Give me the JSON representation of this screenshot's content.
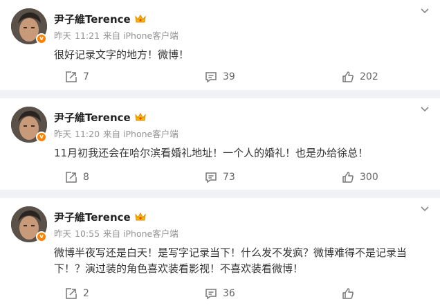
{
  "posts": [
    {
      "user": "尹子維Terence",
      "date": "昨天",
      "time": "11:21",
      "source": "来自 iPhone客户端",
      "text": "很好记录文字的地方！微博！",
      "reposts": "7",
      "comments": "39",
      "likes": "202"
    },
    {
      "user": "尹子維Terence",
      "date": "昨天",
      "time": "11:20",
      "source": "来自 iPhone客户端",
      "text": "11月初我还会在哈尔滨看婚礼地址！一个人的婚礼！也是办给徐总！",
      "reposts": "8",
      "comments": "73",
      "likes": "300"
    },
    {
      "user": "尹子維Terence",
      "date": "昨天",
      "time": "10:55",
      "source": "来自 iPhone客户端",
      "text": "微博半夜写还是白天！是写字记录当下！什么发不发疯？微博难得不是记录当下！？演过装的角色喜欢装看影视！不喜欢装看微博！",
      "reposts": "2",
      "comments": "36",
      "likes": ""
    }
  ],
  "colors": {
    "background": "#f1f2f5",
    "card": "#ffffff",
    "meta": "#939393",
    "verified": "#ff8200"
  }
}
